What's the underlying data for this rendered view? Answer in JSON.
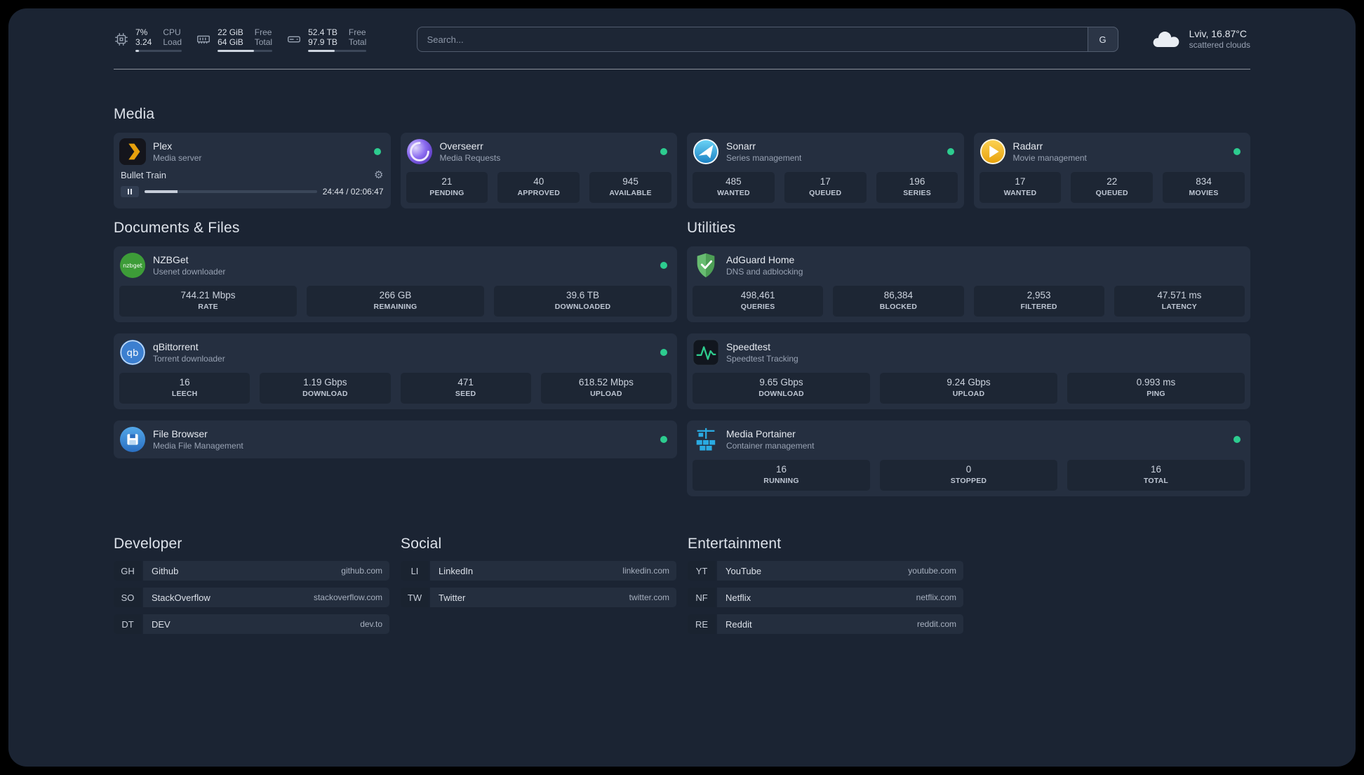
{
  "colors": {
    "panel-bg": "#1b2433",
    "card-bg": "#252f40",
    "tile-bg": "#1d2634",
    "status-green": "#2dcc8f"
  },
  "header": {
    "cpu": {
      "rows": [
        {
          "value": "7%",
          "label": "CPU"
        },
        {
          "value": "3.24",
          "label": "Load"
        }
      ],
      "progress_pct": 7
    },
    "memory": {
      "rows": [
        {
          "value": "22 GiB",
          "label": "Free"
        },
        {
          "value": "64 GiB",
          "label": "Total"
        }
      ],
      "progress_pct": 66
    },
    "disk": {
      "rows": [
        {
          "value": "52.4 TB",
          "label": "Free"
        },
        {
          "value": "97.9 TB",
          "label": "Total"
        }
      ],
      "progress_pct": 46
    },
    "search": {
      "placeholder": "Search...",
      "provider": "G"
    },
    "weather": {
      "location": "Lviv, 16.87°C",
      "condition": "scattered clouds"
    }
  },
  "media": {
    "title": "Media",
    "plex": {
      "name": "Plex",
      "desc": "Media server",
      "now_playing": {
        "title": "Bullet Train",
        "time": "24:44 / 02:06:47",
        "progress_pct": 19
      }
    },
    "overseerr": {
      "name": "Overseerr",
      "desc": "Media Requests",
      "stats": [
        {
          "value": "21",
          "label": "PENDING"
        },
        {
          "value": "40",
          "label": "APPROVED"
        },
        {
          "value": "945",
          "label": "AVAILABLE"
        }
      ]
    },
    "sonarr": {
      "name": "Sonarr",
      "desc": "Series management",
      "stats": [
        {
          "value": "485",
          "label": "WANTED"
        },
        {
          "value": "17",
          "label": "QUEUED"
        },
        {
          "value": "196",
          "label": "SERIES"
        }
      ]
    },
    "radarr": {
      "name": "Radarr",
      "desc": "Movie management",
      "stats": [
        {
          "value": "17",
          "label": "WANTED"
        },
        {
          "value": "22",
          "label": "QUEUED"
        },
        {
          "value": "834",
          "label": "MOVIES"
        }
      ]
    }
  },
  "documents": {
    "title": "Documents & Files",
    "nzbget": {
      "name": "NZBGet",
      "desc": "Usenet downloader",
      "stats": [
        {
          "value": "744.21 Mbps",
          "label": "RATE"
        },
        {
          "value": "266 GB",
          "label": "REMAINING"
        },
        {
          "value": "39.6 TB",
          "label": "DOWNLOADED"
        }
      ]
    },
    "qbittorrent": {
      "name": "qBittorrent",
      "desc": "Torrent downloader",
      "stats": [
        {
          "value": "16",
          "label": "LEECH"
        },
        {
          "value": "1.19 Gbps",
          "label": "DOWNLOAD"
        },
        {
          "value": "471",
          "label": "SEED"
        },
        {
          "value": "618.52 Mbps",
          "label": "UPLOAD"
        }
      ]
    },
    "filebrowser": {
      "name": "File Browser",
      "desc": "Media File Management"
    }
  },
  "utilities": {
    "title": "Utilities",
    "adguard": {
      "name": "AdGuard Home",
      "desc": "DNS and adblocking",
      "stats": [
        {
          "value": "498,461",
          "label": "QUERIES"
        },
        {
          "value": "86,384",
          "label": "BLOCKED"
        },
        {
          "value": "2,953",
          "label": "FILTERED"
        },
        {
          "value": "47.571 ms",
          "label": "LATENCY"
        }
      ]
    },
    "speedtest": {
      "name": "Speedtest",
      "desc": "Speedtest Tracking",
      "stats": [
        {
          "value": "9.65 Gbps",
          "label": "DOWNLOAD"
        },
        {
          "value": "9.24 Gbps",
          "label": "UPLOAD"
        },
        {
          "value": "0.993 ms",
          "label": "PING"
        }
      ]
    },
    "portainer": {
      "name": "Media Portainer",
      "desc": "Container management",
      "stats": [
        {
          "value": "16",
          "label": "RUNNING"
        },
        {
          "value": "0",
          "label": "STOPPED"
        },
        {
          "value": "16",
          "label": "TOTAL"
        }
      ]
    }
  },
  "bookmarks": {
    "developer": {
      "title": "Developer",
      "items": [
        {
          "abbr": "GH",
          "name": "Github",
          "url": "github.com"
        },
        {
          "abbr": "SO",
          "name": "StackOverflow",
          "url": "stackoverflow.com"
        },
        {
          "abbr": "DT",
          "name": "DEV",
          "url": "dev.to"
        }
      ]
    },
    "social": {
      "title": "Social",
      "items": [
        {
          "abbr": "LI",
          "name": "LinkedIn",
          "url": "linkedin.com"
        },
        {
          "abbr": "TW",
          "name": "Twitter",
          "url": "twitter.com"
        }
      ]
    },
    "entertainment": {
      "title": "Entertainment",
      "items": [
        {
          "abbr": "YT",
          "name": "YouTube",
          "url": "youtube.com"
        },
        {
          "abbr": "NF",
          "name": "Netflix",
          "url": "netflix.com"
        },
        {
          "abbr": "RE",
          "name": "Reddit",
          "url": "reddit.com"
        }
      ]
    }
  }
}
